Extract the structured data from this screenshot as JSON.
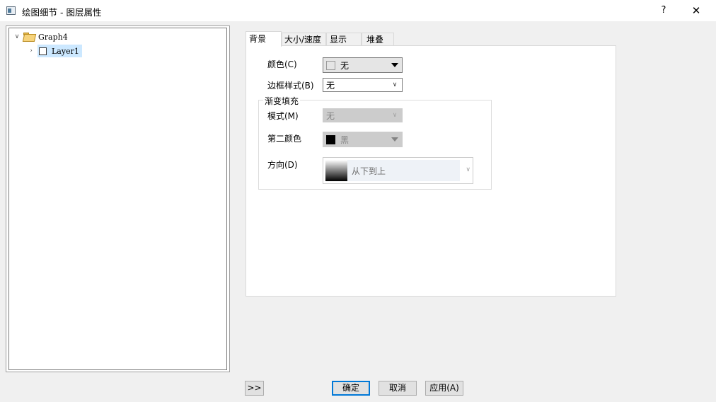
{
  "window": {
    "title": "绘图细节 - 图层属性",
    "help_label": "?",
    "close_label": "✕"
  },
  "tree": {
    "root": {
      "label": "Graph4",
      "expanded": true,
      "icon": "folder-open-icon"
    },
    "children": [
      {
        "label": "Layer1",
        "selected": true,
        "checked": false
      }
    ]
  },
  "tabs": [
    {
      "label": "背景",
      "active": true
    },
    {
      "label": "大小/速度",
      "active": false
    },
    {
      "label": "显示",
      "active": false
    },
    {
      "label": "堆叠",
      "active": false
    }
  ],
  "background": {
    "color_label": "颜色(C)",
    "color_value": "无",
    "color_swatch": "#e5e5e5",
    "border_style_label": "边框样式(B)",
    "border_style_value": "无",
    "gradient": {
      "group_title": "渐变填充",
      "mode_label": "模式(M)",
      "mode_value": "无",
      "second_color_label": "第二颜色",
      "second_color_value": "黑",
      "second_color_swatch": "#000000",
      "direction_label": "方向(D)",
      "direction_value": "从下到上"
    }
  },
  "footer": {
    "expand_label": ">>",
    "ok_label": "确定",
    "cancel_label": "取消",
    "apply_label": "应用(A)"
  },
  "colors": {
    "accent": "#0078d7",
    "selection": "#cce8ff",
    "dialog_bg": "#f0f0f0"
  }
}
